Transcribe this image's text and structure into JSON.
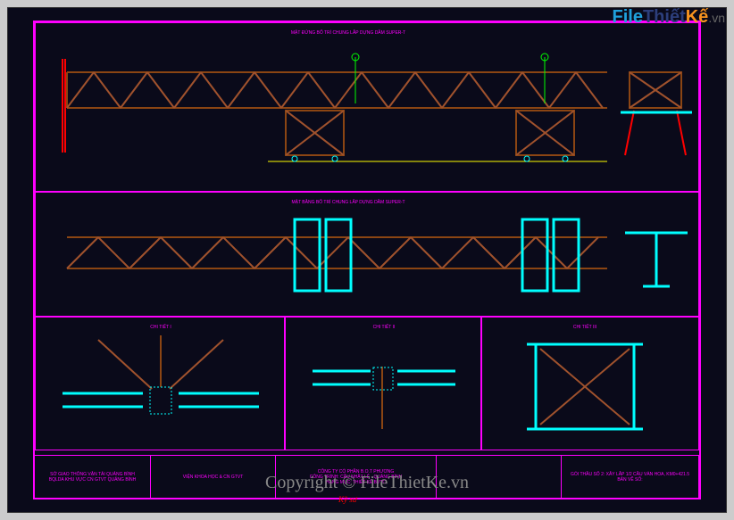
{
  "watermark": {
    "part1": "File",
    "part2": "Thiết",
    "part3": "Kế",
    "suffix": ".vn"
  },
  "copyright": "Copyright © FileThietKe.vn",
  "titleblock": {
    "cell1_line1": "SỞ GIAO THÔNG VẬN TẢI QUẢNG BÌNH",
    "cell1_line2": "BQLDA KHU VỰC CN GTVT QUẢNG BÌNH",
    "cell2_line1": "VIỆN KHOA HỌC & CN GTVT",
    "cell3_line1": "CÔNG TY CỔ PHẦN B.O.T PHƯƠNG",
    "cell3_line2": "CÔNG TRÌNH: CẦU NHẬT LỆ - QUẢNG BÌNH",
    "cell3_line3": "HẠNG MỤC: THIẾT KẾ BVTC",
    "cell5_line1": "GÓI THẦU SỐ 2: XÂY LẮP 1/2 CẦU VÀN HOA, KM0+421.5",
    "cell5_line2": "BẢN VẼ SỐ:"
  },
  "sections": {
    "s1_title": "MẶT ĐỨNG BỐ TRÍ CHUNG LẮP DỰNG DẦM SUPER-T",
    "s2_title": "MẶT BẰNG BỐ TRÍ CHUNG LẮP DỰNG DẦM SUPER-T",
    "s3_title": "CHI TIẾT I",
    "s4_title": "CHI TIẾT II",
    "s5_title": "CHI TIẾT III"
  },
  "signature": "Kỹ sư"
}
